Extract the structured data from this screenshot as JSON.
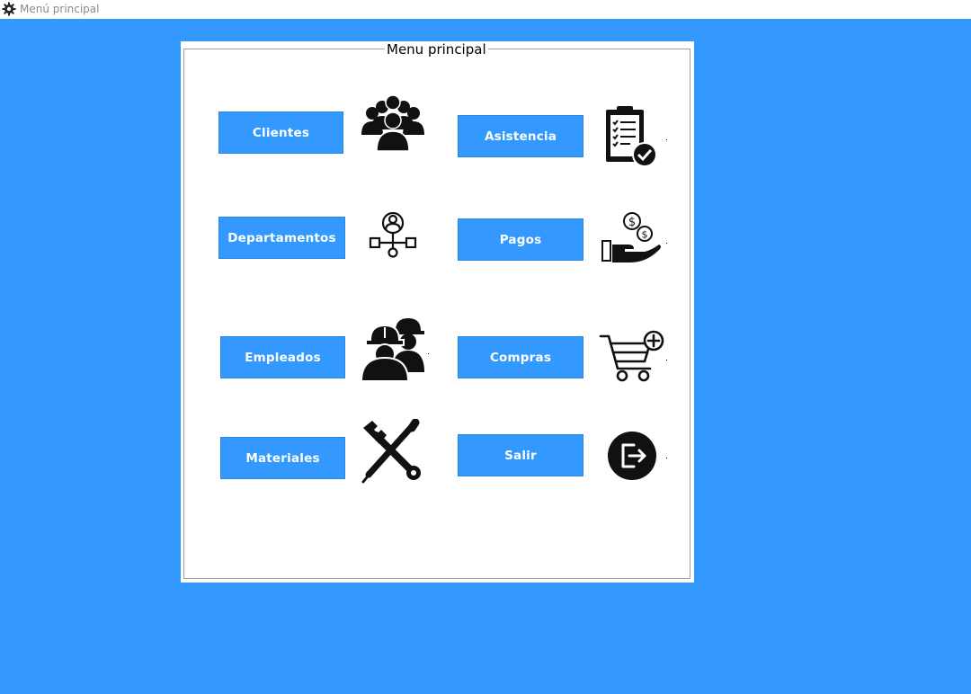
{
  "window": {
    "title": "Menú principal",
    "icon": "gear-icon"
  },
  "panel": {
    "legend": "Menu principal"
  },
  "menu": {
    "clientes": {
      "label": "Clientes",
      "icon": "group-users-icon"
    },
    "asistencia": {
      "label": "Asistencia",
      "icon": "clipboard-check-icon"
    },
    "departamentos": {
      "label": "Departamentos",
      "icon": "org-chart-icon"
    },
    "pagos": {
      "label": "Pagos",
      "icon": "payment-hand-icon"
    },
    "empleados": {
      "label": "Empleados",
      "icon": "workers-icon"
    },
    "compras": {
      "label": "Compras",
      "icon": "cart-add-icon"
    },
    "materiales": {
      "label": "Materiales",
      "icon": "tools-icon"
    },
    "salir": {
      "label": "Salir",
      "icon": "exit-icon"
    }
  },
  "colors": {
    "background": "#3399ff",
    "button": "#3399ff",
    "panel": "#ffffff"
  }
}
